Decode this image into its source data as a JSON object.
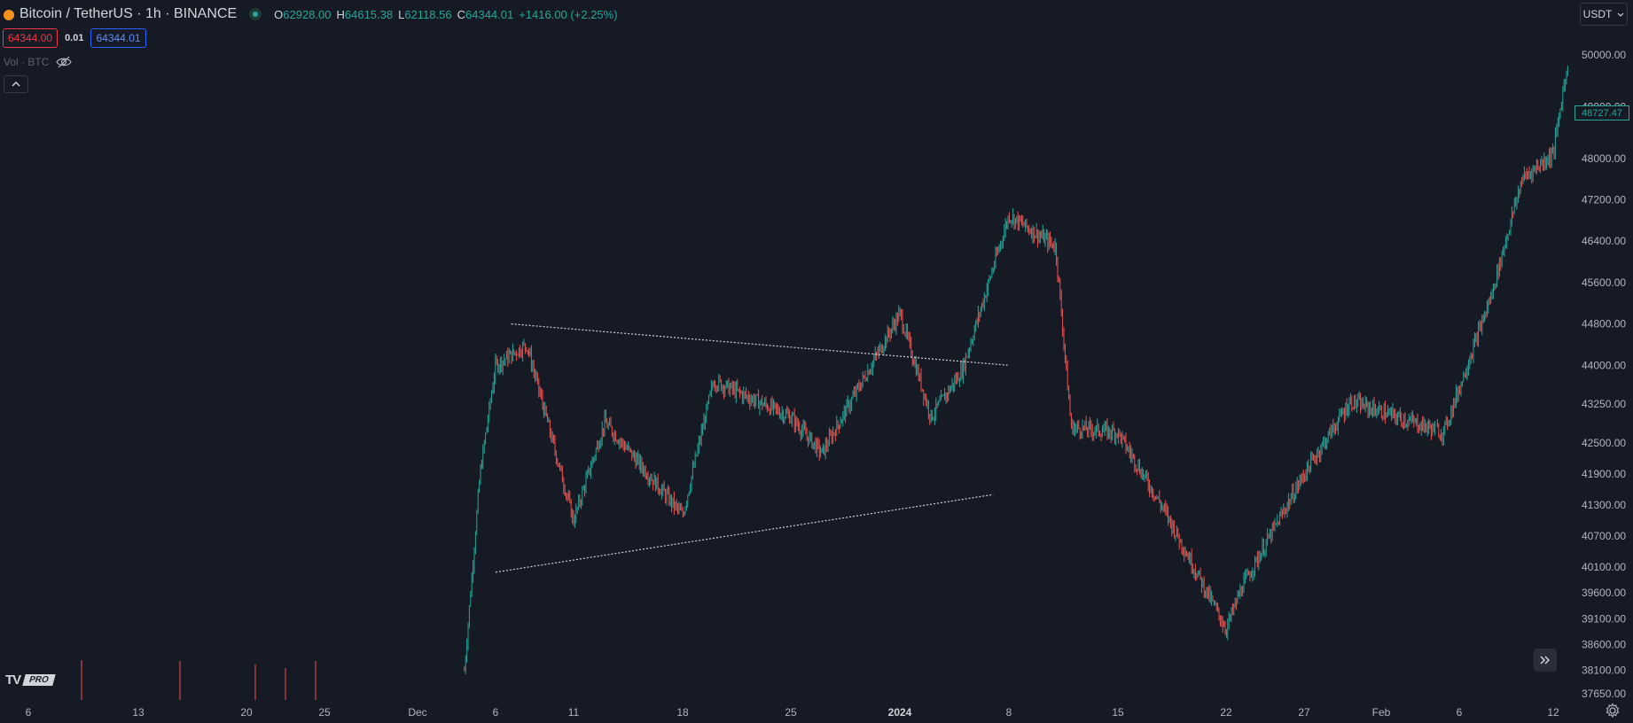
{
  "header": {
    "symbol_title": "Bitcoin / TetherUS · 1h · BINANCE",
    "ohlc": [
      {
        "key": "O",
        "value": "62928.00"
      },
      {
        "key": "H",
        "value": "64615.38"
      },
      {
        "key": "L",
        "value": "62118.56"
      },
      {
        "key": "C",
        "value": "64344.01"
      }
    ],
    "change": "+1416.00 (+2.25%)",
    "icon": "bitcoin-coin-icon"
  },
  "trade": {
    "sell_price": "64344.00",
    "spread": "0.01",
    "buy_price": "64344.01"
  },
  "volume_indicator": {
    "label": "Vol · BTC",
    "icon": "eye-hidden-icon"
  },
  "currency": {
    "label": "USDT"
  },
  "last_price_tag": "48727.47",
  "price_axis": {
    "labels": [
      {
        "value": 50000,
        "text": "50000.00"
      },
      {
        "value": 49000,
        "text": "49000.00"
      },
      {
        "value": 48000,
        "text": "48000.00"
      },
      {
        "value": 47200,
        "text": "47200.00"
      },
      {
        "value": 46400,
        "text": "46400.00"
      },
      {
        "value": 45600,
        "text": "45600.00"
      },
      {
        "value": 44800,
        "text": "44800.00"
      },
      {
        "value": 44000,
        "text": "44000.00"
      },
      {
        "value": 43250,
        "text": "43250.00"
      },
      {
        "value": 42500,
        "text": "42500.00"
      },
      {
        "value": 41900,
        "text": "41900.00"
      },
      {
        "value": 41300,
        "text": "41300.00"
      },
      {
        "value": 40700,
        "text": "40700.00"
      },
      {
        "value": 40100,
        "text": "40100.00"
      },
      {
        "value": 39600,
        "text": "39600.00"
      },
      {
        "value": 39100,
        "text": "39100.00"
      },
      {
        "value": 38600,
        "text": "38600.00"
      },
      {
        "value": 38100,
        "text": "38100.00"
      },
      {
        "value": 37650,
        "text": "37650.00"
      }
    ]
  },
  "time_axis": {
    "labels": [
      {
        "text": "6",
        "bold": false
      },
      {
        "text": "13",
        "bold": false
      },
      {
        "text": "20",
        "bold": false
      },
      {
        "text": "25",
        "bold": false
      },
      {
        "text": "Dec",
        "bold": false
      },
      {
        "text": "6",
        "bold": false
      },
      {
        "text": "11",
        "bold": false
      },
      {
        "text": "18",
        "bold": false
      },
      {
        "text": "25",
        "bold": false
      },
      {
        "text": "2024",
        "bold": true
      },
      {
        "text": "8",
        "bold": false
      },
      {
        "text": "15",
        "bold": false
      },
      {
        "text": "22",
        "bold": false
      },
      {
        "text": "27",
        "bold": false
      },
      {
        "text": "Feb",
        "bold": false
      },
      {
        "text": "6",
        "bold": false
      },
      {
        "text": "12",
        "bold": false
      }
    ]
  },
  "logo": {
    "mark": "TV",
    "badge": "PRO"
  },
  "colors": {
    "background": "#161a25",
    "up": "#26a69a",
    "down": "#ef5350",
    "text": "#d1d4dc"
  },
  "chart_data": {
    "type": "candlestick",
    "price_series": {
      "description_points": [
        {
          "t": "Dec 4",
          "price": 38100
        },
        {
          "t": "Dec 5",
          "price": 41900
        },
        {
          "t": "Dec 6",
          "price": 44000
        },
        {
          "t": "Dec 8",
          "price": 44400
        },
        {
          "t": "Dec 11",
          "price": 41000
        },
        {
          "t": "Dec 13",
          "price": 42900
        },
        {
          "t": "Dec 18",
          "price": 41100
        },
        {
          "t": "Dec 20",
          "price": 43700
        },
        {
          "t": "Dec 25",
          "price": 43000
        },
        {
          "t": "Dec 27",
          "price": 42300
        },
        {
          "t": "Jan 1",
          "price": 45000
        },
        {
          "t": "Jan 3",
          "price": 43000
        },
        {
          "t": "Jan 5",
          "price": 43900
        },
        {
          "t": "Jan 8",
          "price": 46900
        },
        {
          "t": "Jan 11",
          "price": 46300
        },
        {
          "t": "Jan 12",
          "price": 42800
        },
        {
          "t": "Jan 15",
          "price": 42700
        },
        {
          "t": "Jan 18",
          "price": 41200
        },
        {
          "t": "Jan 22",
          "price": 38900
        },
        {
          "t": "Jan 23",
          "price": 39700
        },
        {
          "t": "Jan 27",
          "price": 41900
        },
        {
          "t": "Jan 30",
          "price": 43300
        },
        {
          "t": "Feb 5",
          "price": 42700
        },
        {
          "t": "Feb 8",
          "price": 45300
        },
        {
          "t": "Feb 10",
          "price": 47600
        },
        {
          "t": "Feb 12",
          "price": 48100
        },
        {
          "t": "Feb 13",
          "price": 50000
        }
      ]
    },
    "trendlines": [
      {
        "style": "dotted",
        "from": {
          "t": "Dec 7",
          "price": 44800
        },
        "to": {
          "t": "Jan 8",
          "price": 44000
        }
      },
      {
        "style": "dotted",
        "from": {
          "t": "Dec 6",
          "price": 40000
        },
        "to": {
          "t": "Jan 7",
          "price": 41500
        }
      }
    ],
    "xlabel": "",
    "ylabel": "",
    "grid": false
  }
}
